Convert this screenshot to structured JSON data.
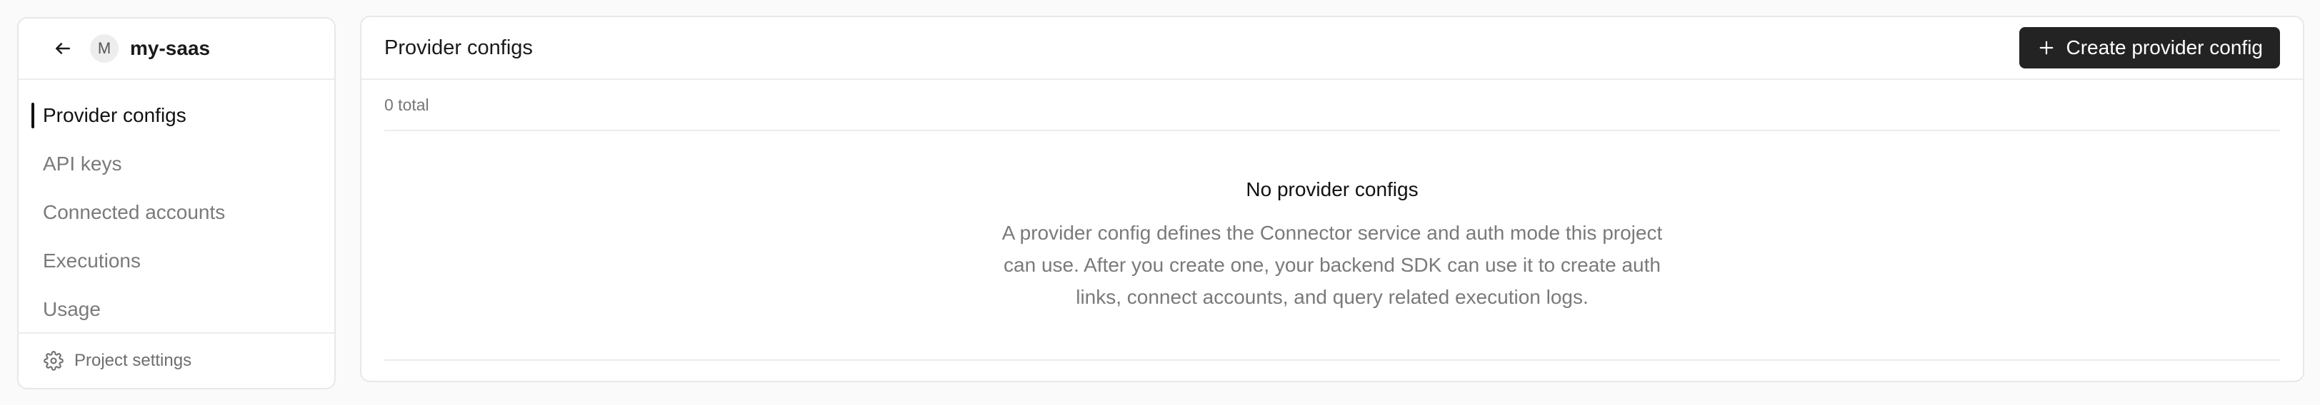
{
  "sidebar": {
    "project_initial": "M",
    "project_name": "my-saas",
    "nav_items": [
      {
        "label": "Provider configs",
        "active": true
      },
      {
        "label": "API keys",
        "active": false
      },
      {
        "label": "Connected accounts",
        "active": false
      },
      {
        "label": "Executions",
        "active": false
      },
      {
        "label": "Usage",
        "active": false
      }
    ],
    "footer_label": "Project settings",
    "icons": {
      "back": "arrow-left-icon",
      "settings": "gear-icon"
    }
  },
  "main": {
    "title": "Provider configs",
    "create_button_label": "Create provider config",
    "create_icon": "plus-icon",
    "count_text": "0 total",
    "empty_state": {
      "title": "No provider configs",
      "description": "A provider config defines the Connector service and auth mode this project can use. After you create one, your backend SDK can use it to create auth links, connect accounts, and query related execution logs."
    }
  },
  "colors": {
    "background": "#fafafa",
    "card": "#ffffff",
    "border": "#e8e8e8",
    "primary_button": "#232323",
    "muted_text": "#7a7a7a"
  }
}
